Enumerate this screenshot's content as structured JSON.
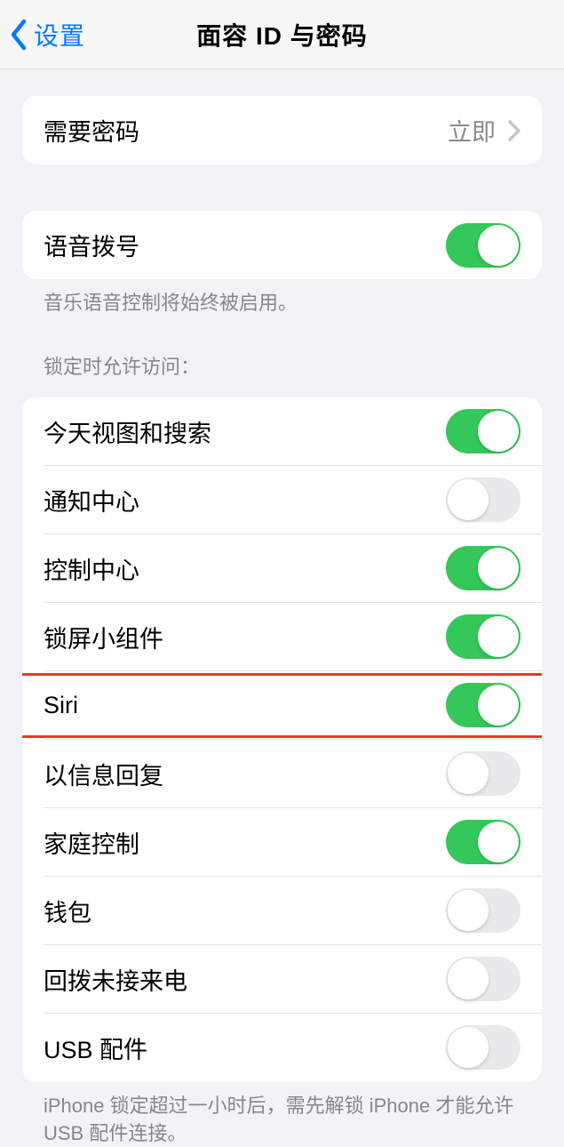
{
  "nav": {
    "back": "设置",
    "title": "面容 ID 与密码"
  },
  "group1": {
    "require_label": "需要密码",
    "require_value": "立即"
  },
  "group2": {
    "voice_dial": "语音拨号",
    "voice_dial_on": true,
    "footer": "音乐语音控制将始终被启用。"
  },
  "section_header": "锁定时允许访问：",
  "access": {
    "items": [
      {
        "label": "今天视图和搜索",
        "on": true
      },
      {
        "label": "通知中心",
        "on": false
      },
      {
        "label": "控制中心",
        "on": true
      },
      {
        "label": "锁屏小组件",
        "on": true
      },
      {
        "label": "Siri",
        "on": true,
        "highlight": true
      },
      {
        "label": "以信息回复",
        "on": false
      },
      {
        "label": "家庭控制",
        "on": true
      },
      {
        "label": "钱包",
        "on": false
      },
      {
        "label": "回拨未接来电",
        "on": false
      },
      {
        "label": "USB 配件",
        "on": false
      }
    ]
  },
  "bottom_footer": "iPhone 锁定超过一小时后，需先解锁 iPhone 才能允许 USB 配件连接。"
}
